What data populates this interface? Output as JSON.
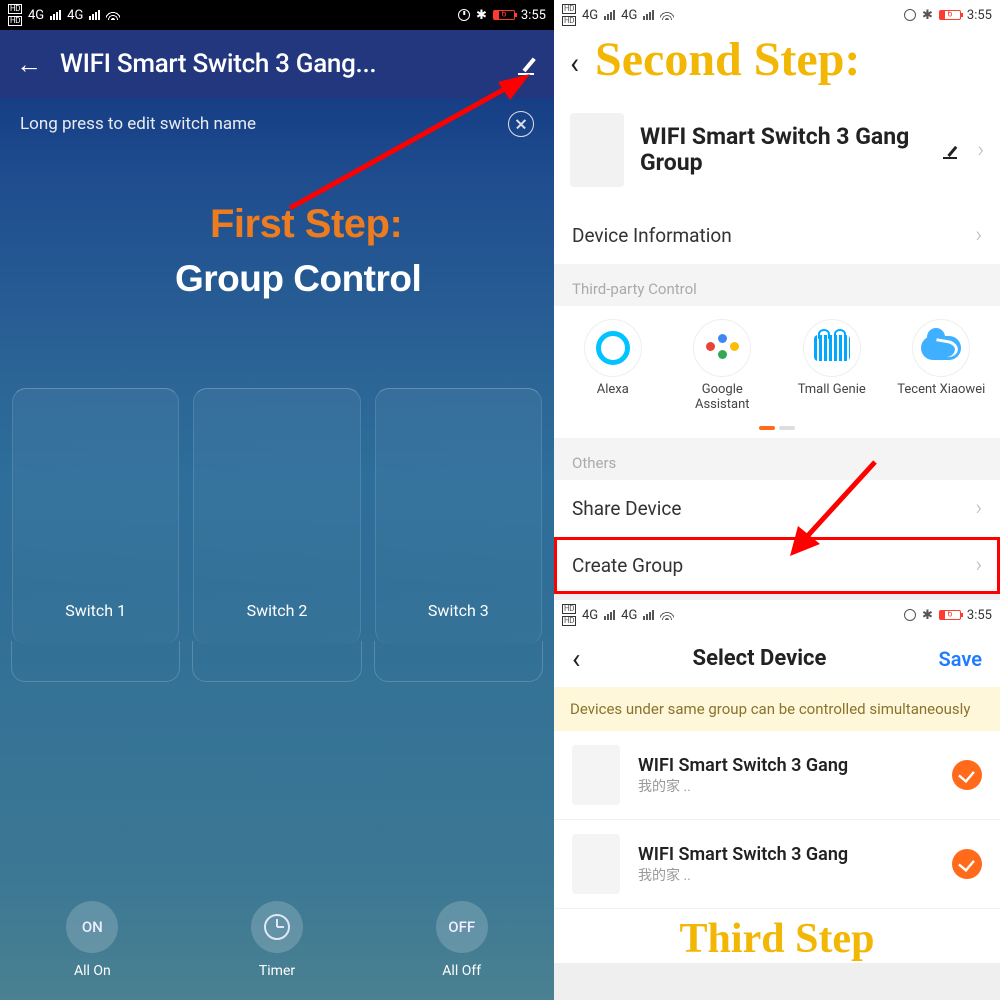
{
  "status": {
    "time": "3:55",
    "battery_pct": "6",
    "carrier_4g": "4G"
  },
  "left": {
    "title": "WIFI Smart Switch 3 Gang...",
    "tip": "Long press to edit switch name",
    "switches": [
      "Switch 1",
      "Switch 2",
      "Switch 3"
    ],
    "bottom": {
      "on_lbl": "ON",
      "on_txt": "All On",
      "timer": "Timer",
      "off_lbl": "OFF",
      "off_txt": "All Off"
    }
  },
  "annot": {
    "first": "First Step:",
    "group": "Group Control",
    "second": "Second Step:",
    "third": "Third Step"
  },
  "right": {
    "device_title": "WIFI Smart Switch 3 Gang Group",
    "rows": {
      "info": "Device Information",
      "third_party": "Third-party Control",
      "others": "Others",
      "share": "Share Device",
      "create": "Create Group"
    },
    "tp": [
      "Alexa",
      "Google Assistant",
      "Tmall Genie",
      "Tecent Xiaowei"
    ]
  },
  "select": {
    "title": "Select Device",
    "save": "Save",
    "banner": "Devices under same group can be controlled simultaneously",
    "items": [
      {
        "name": "WIFI Smart Switch 3 Gang",
        "sub": "我的家 .."
      },
      {
        "name": "WIFI Smart Switch 3 Gang",
        "sub": "我的家 .."
      }
    ]
  }
}
